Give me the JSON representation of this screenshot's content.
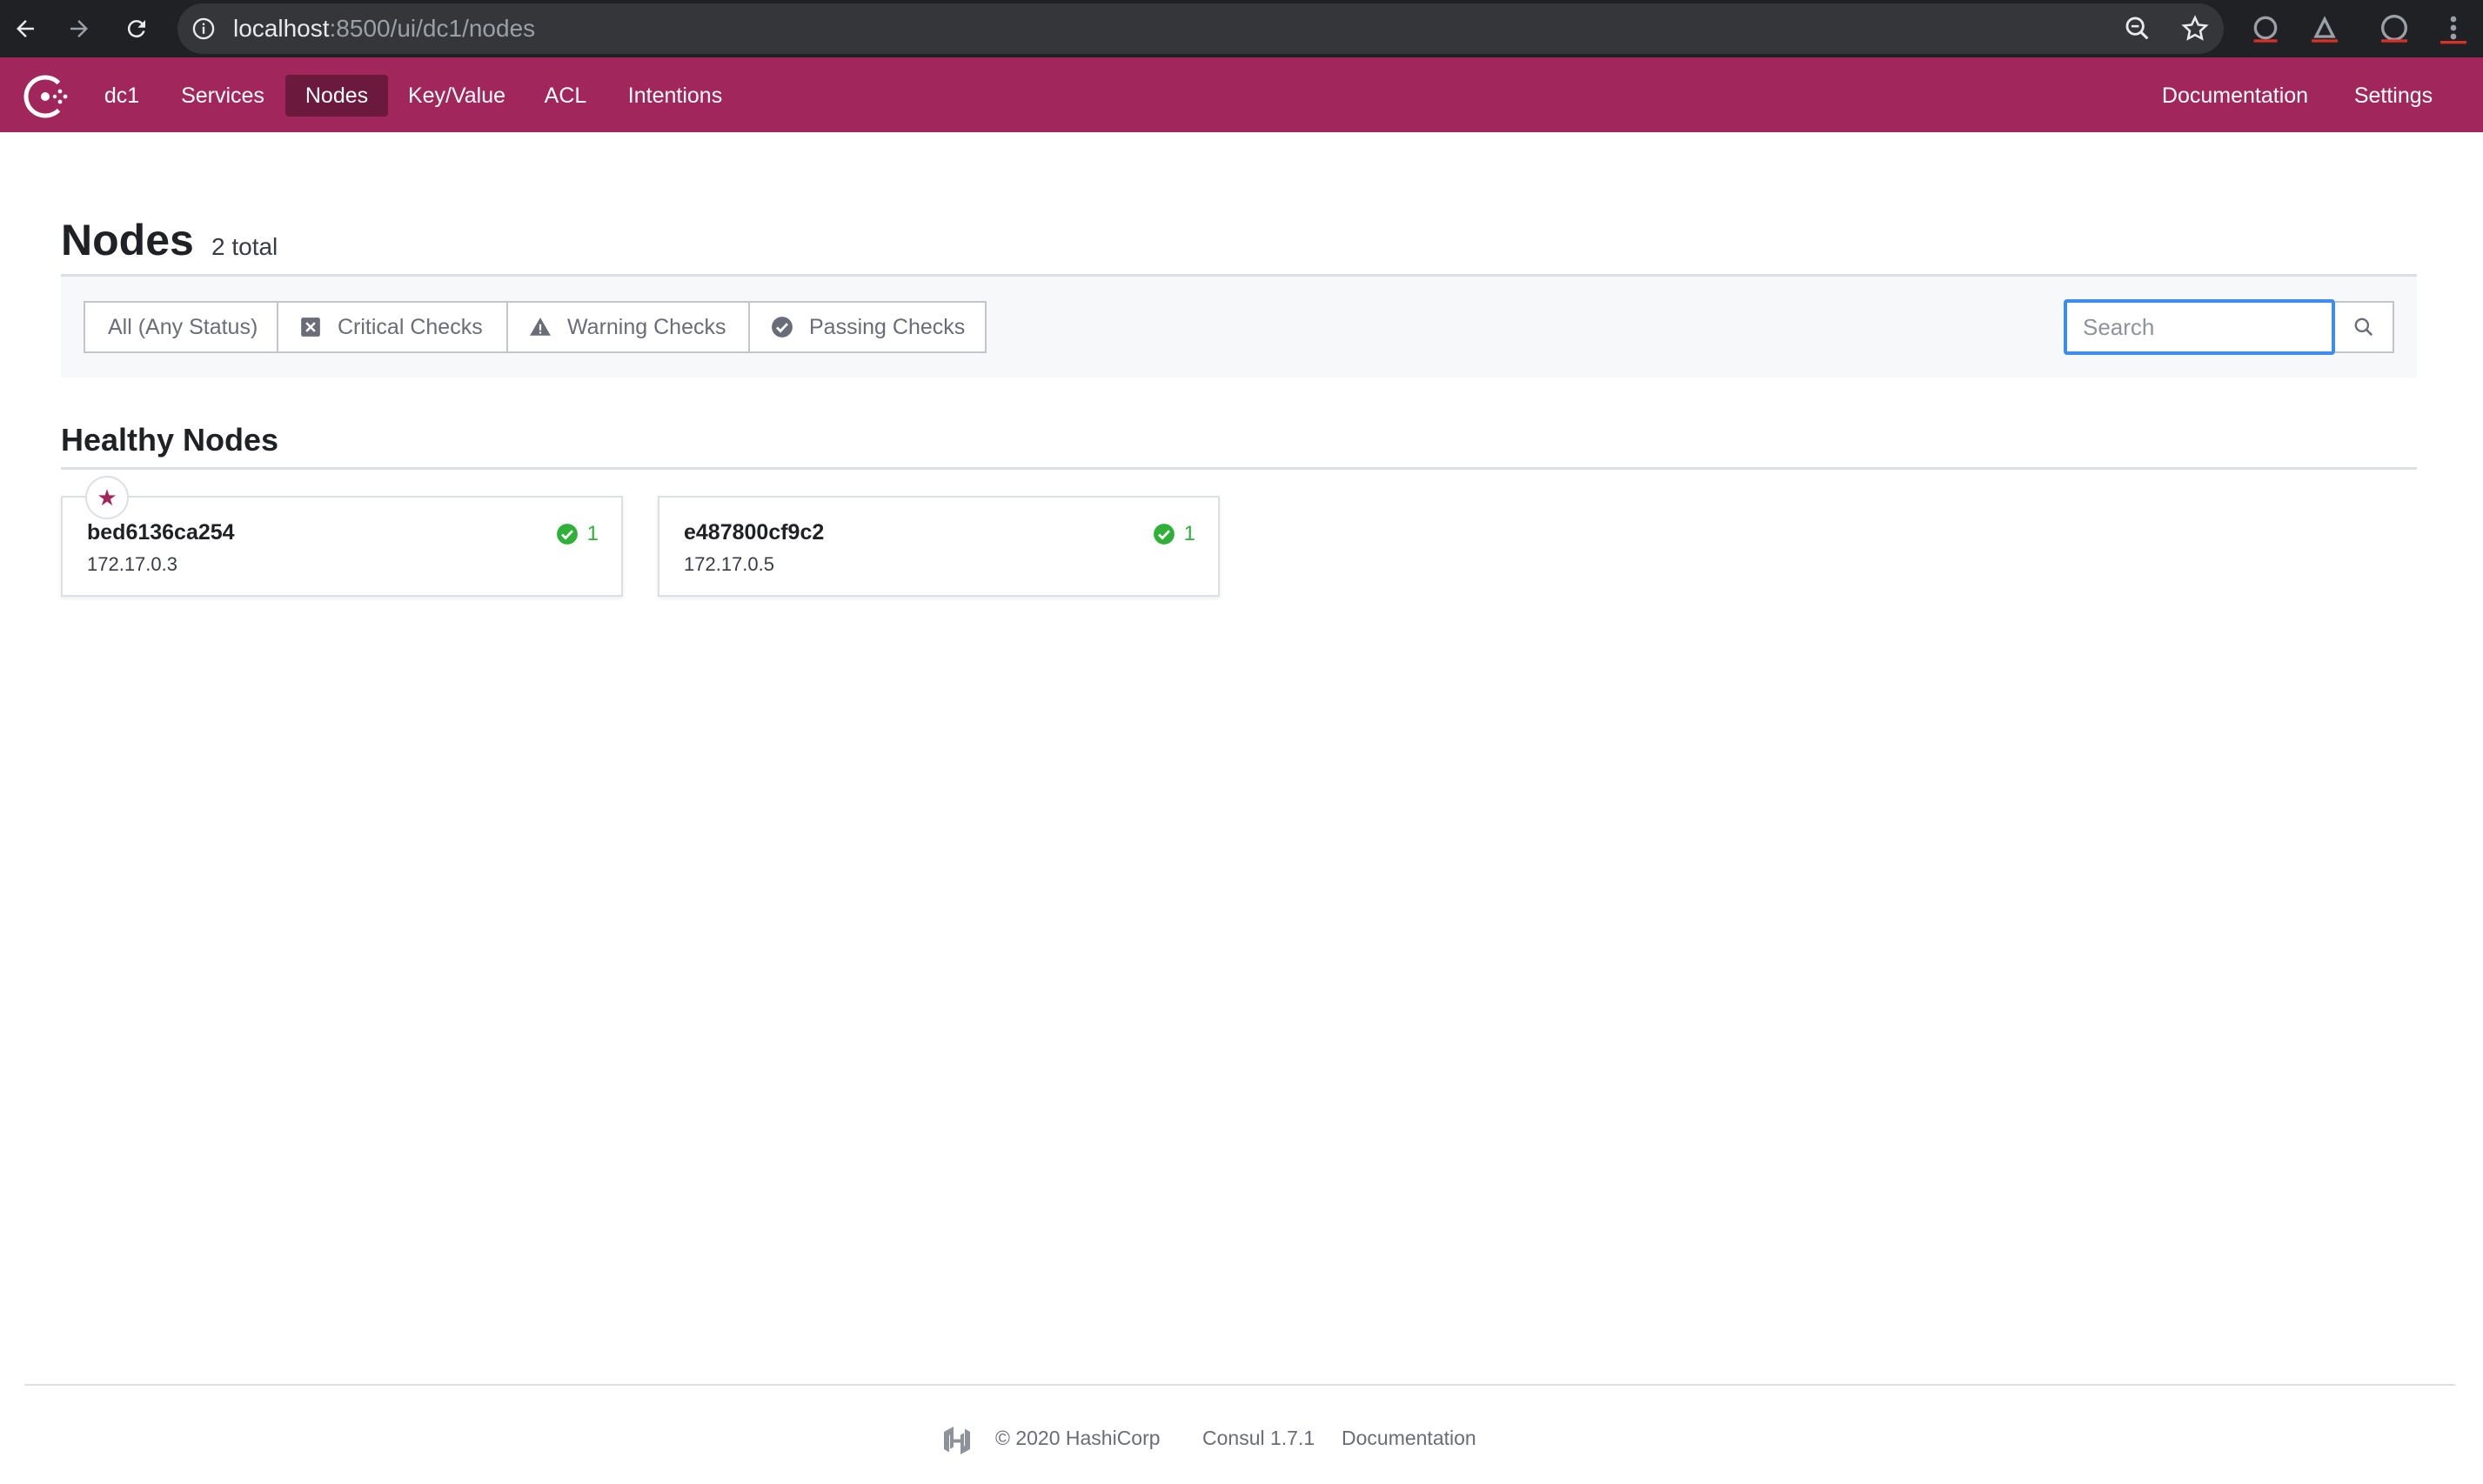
{
  "browser": {
    "url_host": "localhost",
    "url_path": ":8500/ui/dc1/nodes"
  },
  "header": {
    "datacenter": "dc1",
    "nav": [
      {
        "label": "Services"
      },
      {
        "label": "Nodes",
        "active": true
      },
      {
        "label": "Key/Value"
      },
      {
        "label": "ACL"
      },
      {
        "label": "Intentions"
      }
    ],
    "right_nav": [
      {
        "label": "Documentation"
      },
      {
        "label": "Settings"
      }
    ],
    "brand_color": "#a1265b"
  },
  "page": {
    "title": "Nodes",
    "count": "2 total"
  },
  "filters": [
    {
      "label": "All (Any Status)",
      "icon": "none",
      "selected": true
    },
    {
      "label": "Critical Checks",
      "icon": "critical-icon"
    },
    {
      "label": "Warning Checks",
      "icon": "warning-icon"
    },
    {
      "label": "Passing Checks",
      "icon": "passing-icon"
    }
  ],
  "search": {
    "placeholder": "Search"
  },
  "section": {
    "title": "Healthy Nodes"
  },
  "nodes": [
    {
      "name": "bed6136ca254",
      "address": "172.17.0.3",
      "passing": "1",
      "leader": true
    },
    {
      "name": "e487800cf9c2",
      "address": "172.17.0.5",
      "passing": "1",
      "leader": false
    }
  ],
  "footer": {
    "copyright": "© 2020 HashiCorp",
    "version": "Consul 1.7.1",
    "docs": "Documentation"
  },
  "colors": {
    "passing": "#2eb039",
    "focus": "#3d8df0"
  }
}
